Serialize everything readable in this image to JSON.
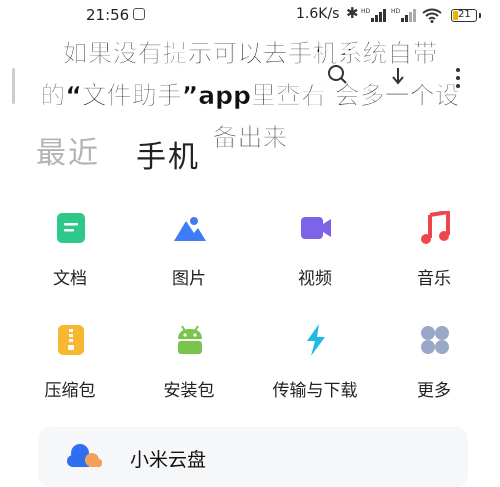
{
  "status_bar": {
    "time": "21:56",
    "network_speed": "1.6K/s",
    "battery": "21",
    "icons": [
      "notification-icon",
      "bluetooth-icon",
      "signal-hd-icon",
      "signal-hd-icon",
      "wifi-icon",
      "battery-icon"
    ]
  },
  "header": {
    "tabs": [
      {
        "label": "最近",
        "active": false
      },
      {
        "label": "手机",
        "active": true
      }
    ],
    "actions": [
      "search-icon",
      "sort-icon",
      "more-icon"
    ]
  },
  "overlay_text": "如果没有提示可以去手机系统自带的“文件助手”app里查看 会多一个设备出来",
  "categories": [
    {
      "label": "文档",
      "icon": "document-icon",
      "color": "#2dc88a"
    },
    {
      "label": "图片",
      "icon": "image-icon",
      "color": "#3f7cf5"
    },
    {
      "label": "视频",
      "icon": "video-icon",
      "color": "#7d63e8"
    },
    {
      "label": "音乐",
      "icon": "music-icon",
      "color": "#f0464b"
    },
    {
      "label": "压缩包",
      "icon": "zip-icon",
      "color": "#f7b731"
    },
    {
      "label": "安装包",
      "icon": "android-icon",
      "color": "#79c44d"
    },
    {
      "label": "传输与下载",
      "icon": "transfer-icon",
      "color": "#21b9e8"
    },
    {
      "label": "更多",
      "icon": "more-grid-icon",
      "color": "#9aa8c7"
    }
  ],
  "cloud": {
    "label": "小米云盘",
    "icon": "cloud-icon"
  }
}
